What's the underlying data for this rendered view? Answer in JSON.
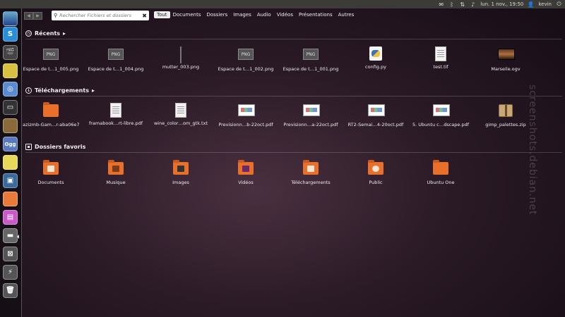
{
  "top_panel": {
    "datetime": "lun. 1 nov., 19:50",
    "user": "kevin"
  },
  "search": {
    "placeholder": "Rechercher Fichiers et dossiers"
  },
  "filters": [
    "Tout",
    "Documents",
    "Dossiers",
    "Images",
    "Audio",
    "Vidéos",
    "Présentations",
    "Autres"
  ],
  "sections": {
    "recents": {
      "title": "Récents",
      "items": [
        "Espace de t…1_005.png",
        "Espace de t…1_004.png",
        "mutter_003.png",
        "Espace de t…1_002.png",
        "Espace de t…1_001.png",
        "config.py",
        "test.tif",
        "Marseile.ogv"
      ]
    },
    "telechargements": {
      "title": "Téléchargements",
      "items": [
        "azizmb-Gam…r-aba06e7",
        "framabook…rt-libre.pdf",
        "wine_color…om_gtk.txt",
        "Previsionn…b-22oct.pdf",
        "Previsionn…a-22oct.pdf",
        "RT2-Semai…4-20oct.pdf",
        "5. Ubuntu c…dscape.pdf",
        "gimp_palettes.zip"
      ]
    },
    "favoris": {
      "title": "Dossiers favoris",
      "items": [
        "Documents",
        "Musique",
        "Images",
        "Vidéos",
        "Téléchargements",
        "Public",
        "Ubuntu One"
      ]
    }
  },
  "watermark": "screenshots.debian.net",
  "thumb_text": "PNG",
  "launcher_badge": "Ogg"
}
